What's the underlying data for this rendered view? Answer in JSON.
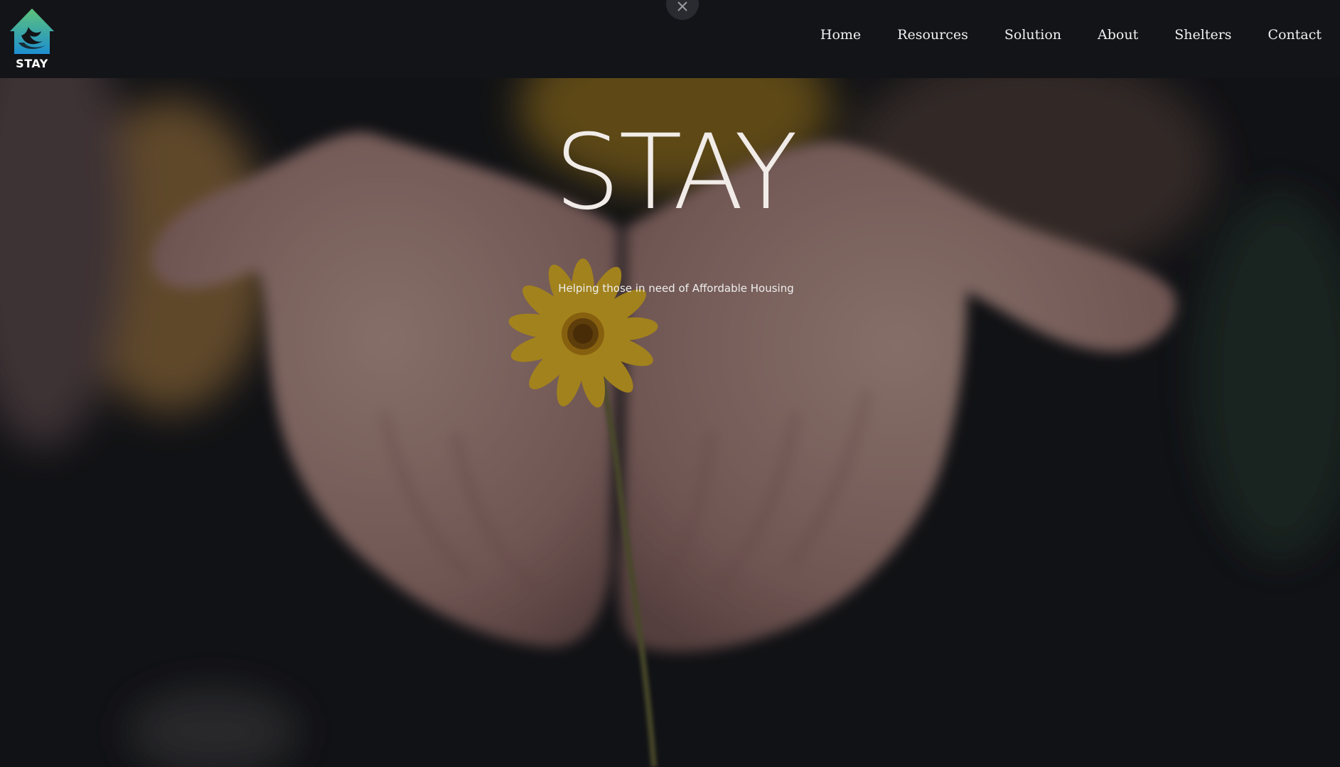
{
  "brand": {
    "logo_text": "STAY",
    "logo_icon": "house-bird-icon",
    "accent_gradient": [
      "#5ec27a",
      "#1d8fd0"
    ]
  },
  "nav": {
    "items": [
      {
        "label": "Home"
      },
      {
        "label": "Resources"
      },
      {
        "label": "Solution"
      },
      {
        "label": "About"
      },
      {
        "label": "Shelters"
      },
      {
        "label": "Contact"
      }
    ]
  },
  "overlay_close": {
    "icon": "close-icon"
  },
  "hero": {
    "title": "STAY",
    "subtitle": "Helping those in need of Affordable Housing",
    "image": "hands-holding-yellow-flower"
  },
  "colors": {
    "navbar_bg": "#131418",
    "text": "#f2f2f2",
    "flower": "#f2c21b"
  }
}
